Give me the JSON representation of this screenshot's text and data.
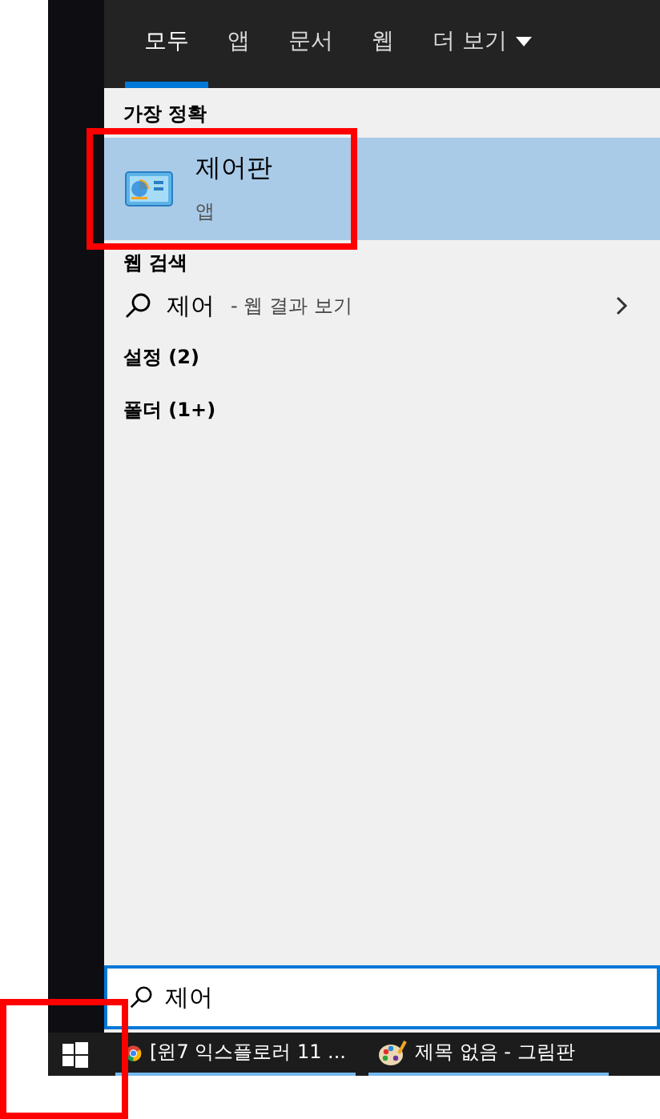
{
  "tabs": [
    {
      "label": "모두",
      "selected": true,
      "kind": "plain"
    },
    {
      "label": "앱",
      "selected": false,
      "kind": "plain"
    },
    {
      "label": "문서",
      "selected": false,
      "kind": "plain"
    },
    {
      "label": "웹",
      "selected": false,
      "kind": "plain"
    },
    {
      "label": "더 보기",
      "selected": false,
      "kind": "dropdown"
    }
  ],
  "best_match": {
    "heading": "가장 정확",
    "item": {
      "title": "제어판",
      "subtitle": "앱",
      "selected": true
    }
  },
  "web_search": {
    "heading": "웹 검색",
    "query": "제어",
    "suffix": "- 웹 결과 보기"
  },
  "sections": [
    {
      "label": "설정 (2)"
    },
    {
      "label": "폴더 (1+)"
    }
  ],
  "search_box": {
    "value": "제어"
  },
  "taskbar": {
    "items": [
      {
        "label": "[윈7 익스플로러 11 ...",
        "kind": "browser"
      },
      {
        "label": "제목 없음 - 그림판",
        "kind": "paint"
      }
    ]
  }
}
